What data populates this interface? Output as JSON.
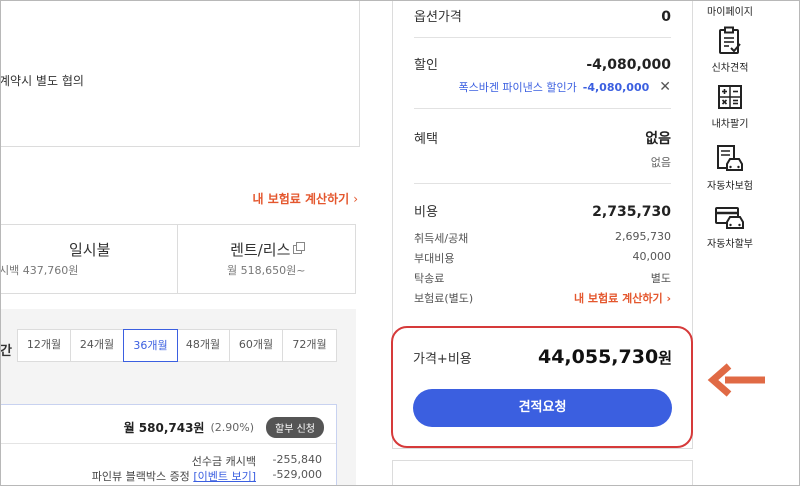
{
  "left": {
    "note_text": "계약시 별도 협의",
    "insurance_link": "내 보험료 계산하기",
    "pay_cards": [
      {
        "title": "일시불",
        "sub": "시백 437,760원"
      },
      {
        "title": "렌트/리스",
        "sub": "월 518,650원~"
      }
    ],
    "term_label": "간",
    "term_tabs": [
      "12개월",
      "24개월",
      "36개월",
      "48개월",
      "60개월",
      "72개월"
    ],
    "active_term": "36개월",
    "monthly": {
      "amount": "월 580,743원",
      "rate": "(2.90%)",
      "installment_button": "할부 신청",
      "cashback_label": "선수금 캐시백",
      "cashback_value": "-255,840",
      "blackbox_label": "파인뷰 블랙박스 증정",
      "event_link": "[이벤트 보기]",
      "blackbox_value": "-529,000"
    }
  },
  "summary": {
    "option_label": "옵션가격",
    "option_value": "0",
    "discount_label": "할인",
    "discount_value": "-4,080,000",
    "discount_detail_label": "폭스바겐 파이낸스 할인가",
    "discount_detail_value": "-4,080,000",
    "benefit_label": "혜택",
    "benefit_value": "없음",
    "benefit_sub": "없음",
    "cost_label": "비용",
    "cost_value": "2,735,730",
    "cost_items": [
      {
        "label": "취득세/공채",
        "value": "2,695,730"
      },
      {
        "label": "부대비용",
        "value": "40,000"
      },
      {
        "label": "탁송료",
        "value": "별도"
      },
      {
        "label": "보험료(별도)",
        "value": "내 보험료 계산하기"
      }
    ],
    "total_label": "가격+비용",
    "total_value": "44,055,730",
    "total_unit": "원",
    "quote_button": "견적요청"
  },
  "sidebar": {
    "items": [
      {
        "label": "마이페이지",
        "icon": "user-icon"
      },
      {
        "label": "신차견적",
        "icon": "clipboard-check-icon"
      },
      {
        "label": "내차팔기",
        "icon": "calculator-icon"
      },
      {
        "label": "자동차보험",
        "icon": "car-document-icon"
      },
      {
        "label": "자동차할부",
        "icon": "car-card-icon"
      }
    ]
  },
  "colors": {
    "accent_blue": "#3b5fe0",
    "highlight_red": "#d63a3a",
    "link_orange": "#e4572e",
    "arrow_orange": "#e06a45"
  }
}
